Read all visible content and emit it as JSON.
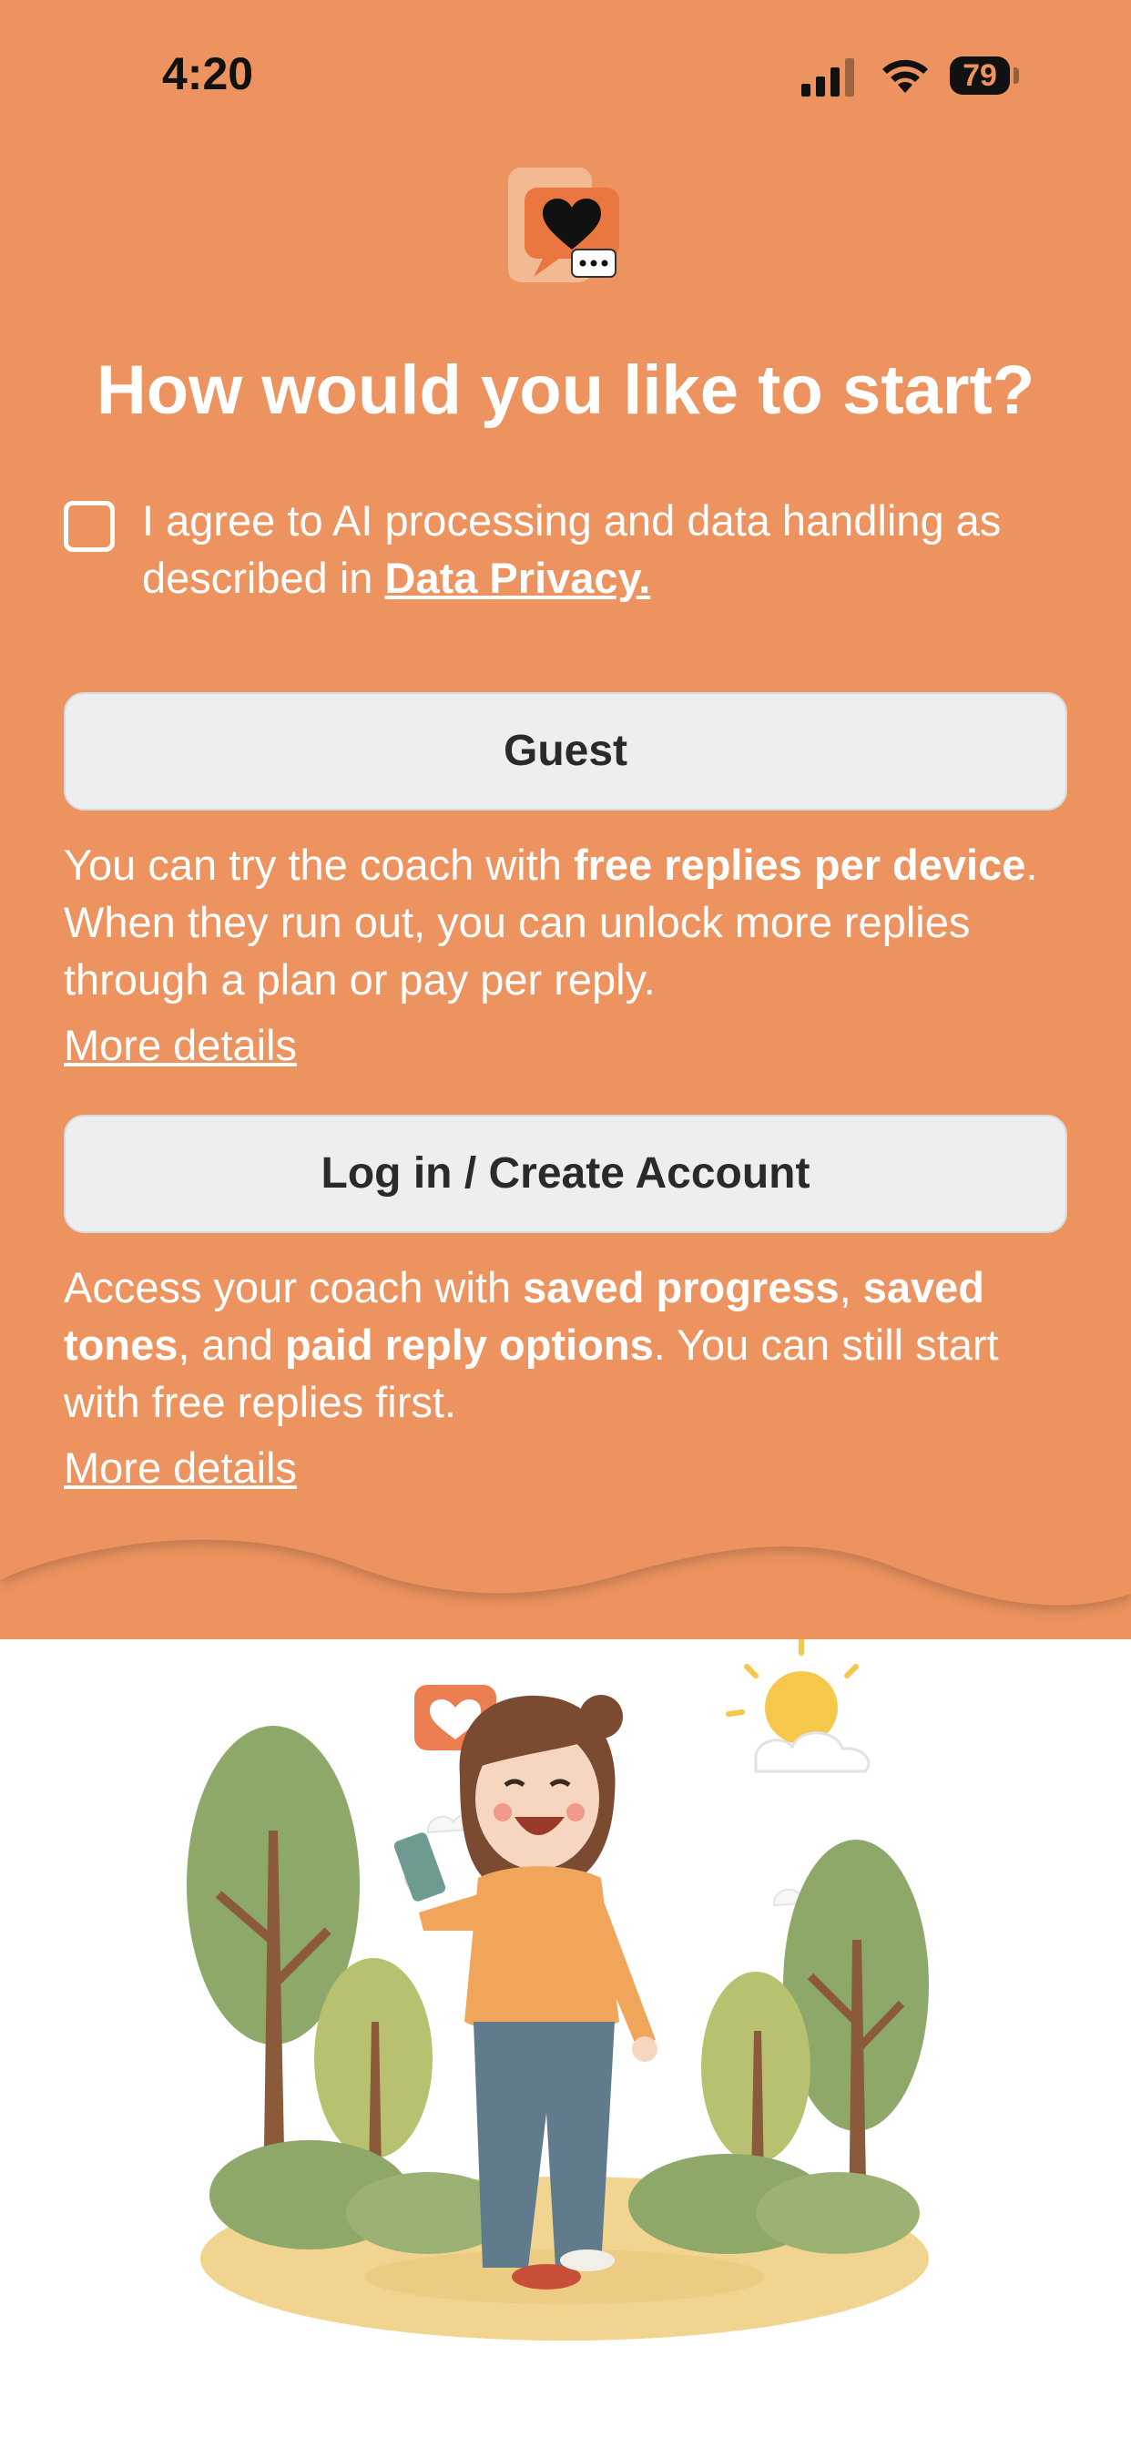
{
  "status_bar": {
    "time": "4:20",
    "battery": "79"
  },
  "title": "How would you like to start?",
  "consent": {
    "text_before": "I agree to AI processing and data handling as described in ",
    "link": "Data Privacy."
  },
  "guest": {
    "button_label": "Guest",
    "desc_1": "You can try the coach with ",
    "desc_bold": "free replies per device",
    "desc_2": ". When they run out, you can unlock more replies through a plan or pay per reply.",
    "more": "More details"
  },
  "account": {
    "button_label": "Log in / Create Account",
    "desc_1": "Access your coach with ",
    "bold_1": "saved progress",
    "sep_1": ", ",
    "bold_2": "saved tones",
    "sep_2": ", and ",
    "bold_3": "paid reply options",
    "desc_2": ". You can still start with free replies first.",
    "more": "More details"
  },
  "colors": {
    "brand": "#ec935f",
    "button": "#edeef0"
  },
  "icons": [
    "signal-icon",
    "wifi-icon",
    "battery-icon",
    "app-logo-heart-chat-icon"
  ]
}
